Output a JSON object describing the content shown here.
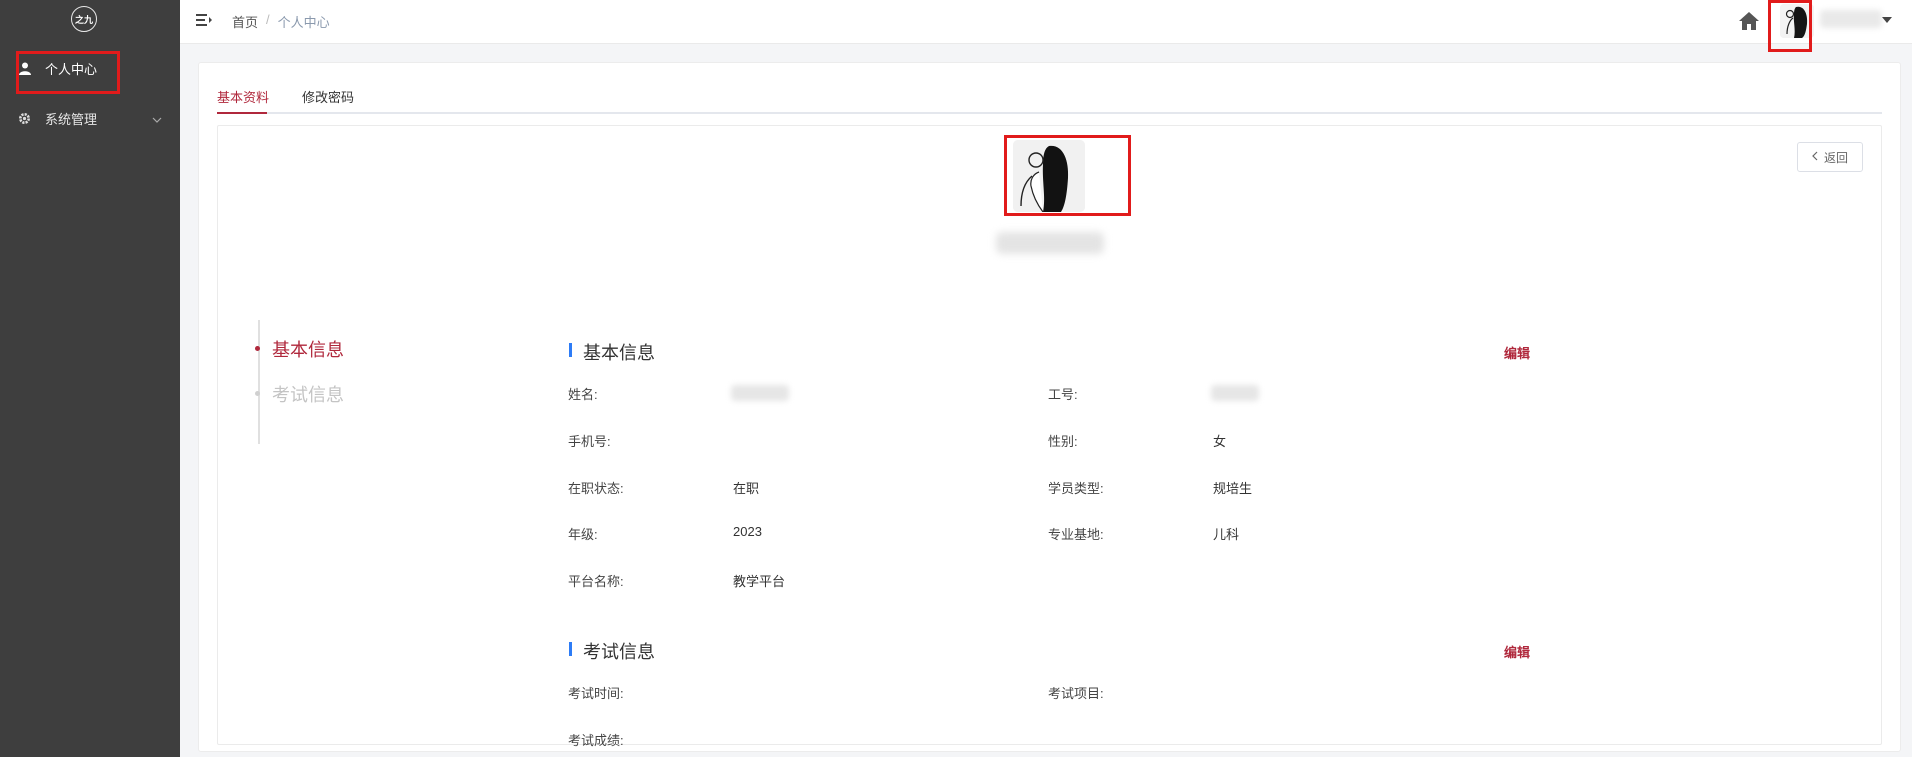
{
  "sidebar": {
    "logo_text": "之九",
    "items": [
      {
        "label": "个人中心",
        "icon": "user-icon",
        "active": true
      },
      {
        "label": "系统管理",
        "icon": "gear-icon",
        "active": false
      }
    ]
  },
  "header": {
    "breadcrumb": [
      "首页",
      "个人中心"
    ],
    "breadcrumb_sep": "/"
  },
  "tabs": [
    {
      "label": "基本资料",
      "active": true
    },
    {
      "label": "修改密码",
      "active": false
    }
  ],
  "profile": {
    "back_label": "返回"
  },
  "anchors": [
    {
      "label": "基本信息",
      "active": true
    },
    {
      "label": "考试信息",
      "active": false
    }
  ],
  "basic_info": {
    "title": "基本信息",
    "edit_label": "编辑",
    "fields": {
      "name_label": "姓名:",
      "job_no_label": "工号:",
      "phone_label": "手机号:",
      "gender_label": "性别:",
      "gender": "女",
      "status_label": "在职状态:",
      "status": "在职",
      "student_type_label": "学员类型:",
      "student_type": "规培生",
      "grade_label": "年级:",
      "grade": "2023",
      "base_label": "专业基地:",
      "base": "儿科",
      "platform_label": "平台名称:",
      "platform": "教学平台"
    }
  },
  "exam_info": {
    "title": "考试信息",
    "edit_label": "编辑",
    "fields": {
      "time_label": "考试时间:",
      "item_label": "考试项目:",
      "score_label": "考试成绩:"
    }
  },
  "colors": {
    "sidebar_bg": "#3e3e3e",
    "accent": "#b0283c",
    "section_bar": "#2d7cf6",
    "highlight_box": "#e11b1b"
  }
}
